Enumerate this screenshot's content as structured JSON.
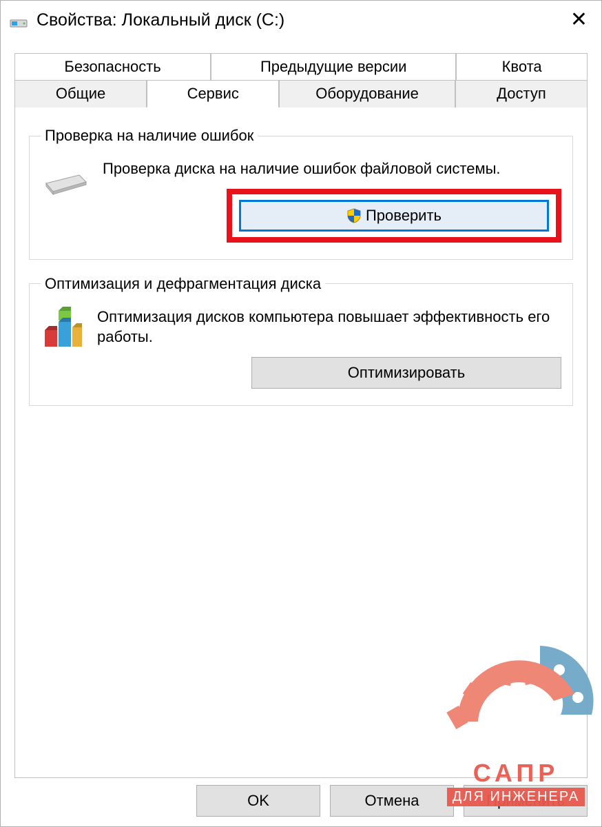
{
  "window": {
    "title": "Свойства: Локальный диск (C:)"
  },
  "tabs": {
    "row1": [
      "Безопасность",
      "Предыдущие версии",
      "Квота"
    ],
    "row2": [
      "Общие",
      "Сервис",
      "Оборудование",
      "Доступ"
    ],
    "active": "Сервис"
  },
  "group_check": {
    "legend": "Проверка на наличие ошибок",
    "desc": "Проверка диска на наличие ошибок файловой системы.",
    "button": "Проверить"
  },
  "group_optimize": {
    "legend": "Оптимизация и дефрагментация диска",
    "desc": "Оптимизация дисков компьютера повышает эффективность его работы.",
    "button": "Оптимизировать"
  },
  "footer": {
    "ok": "OK",
    "cancel": "Отмена",
    "apply": "Применить"
  },
  "watermark": {
    "line1": "САПР",
    "line2": "ДЛЯ ИНЖЕНЕРА"
  }
}
